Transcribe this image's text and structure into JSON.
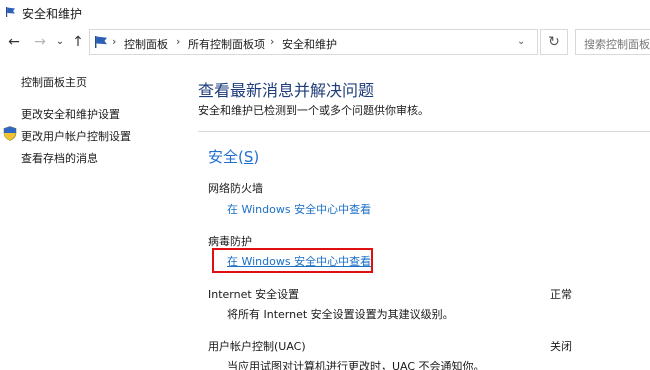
{
  "window": {
    "title": "安全和维护"
  },
  "nav": {
    "back": "←",
    "forward": "→",
    "dropdown_history": "⌄",
    "up": "↑",
    "breadcrumbs": [
      "控制面板",
      "所有控制面板项",
      "安全和维护"
    ],
    "breadcrumb_separator": "›",
    "address_dropdown": "⌄",
    "refresh": "↻",
    "search_placeholder": "搜索控制面板"
  },
  "sidebar": {
    "items": [
      {
        "label": "控制面板主页"
      },
      {
        "label": "更改安全和维护设置"
      },
      {
        "label": "更改用户帐户控制设置"
      },
      {
        "label": "查看存档的消息"
      }
    ]
  },
  "main": {
    "title": "查看最新消息并解决问题",
    "subtitle": "安全和维护已检测到一个或多个问题供你审核。",
    "section": {
      "title_text": "安全(",
      "title_accel": "S",
      "title_end": ")",
      "items": [
        {
          "label": "网络防火墙",
          "link": "在 Windows 安全中心中查看"
        },
        {
          "label": "病毒防护",
          "link": "在 Windows 安全中心中查看"
        },
        {
          "label": "Internet 安全设置",
          "status": "正常",
          "desc": "将所有 Internet 安全设置设置为其建议级别。"
        },
        {
          "label": "用户帐户控制(UAC)",
          "status": "关闭",
          "desc": "当应用试图对计算机进行更改时，UAC 不会通知你。"
        }
      ]
    }
  },
  "colors": {
    "title_blue": "#1e3d7a",
    "link_blue": "#1a6fc7",
    "highlight_red": "#e01010"
  }
}
